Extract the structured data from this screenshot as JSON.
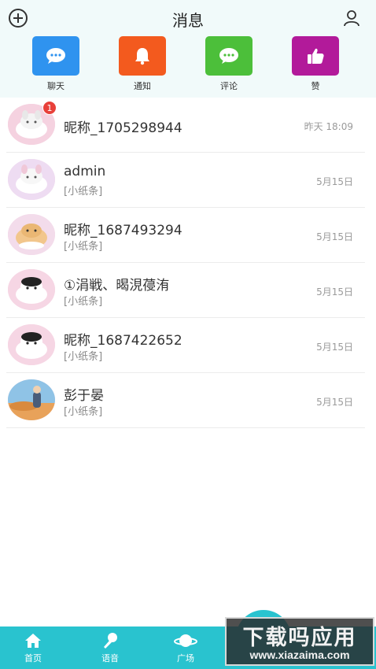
{
  "header": {
    "title": "消息",
    "add_icon": "plus-circle-icon",
    "user_icon": "user-icon"
  },
  "categories": [
    {
      "label": "聊天",
      "icon": "chat-bubble-icon",
      "color": "#2f93ef"
    },
    {
      "label": "通知",
      "icon": "bell-icon",
      "color": "#f35a1e"
    },
    {
      "label": "评论",
      "icon": "comment-icon",
      "color": "#4cbf3a"
    },
    {
      "label": "赞",
      "icon": "thumbs-up-icon",
      "color": "#b21a9a"
    }
  ],
  "messages": [
    {
      "name": "昵称_1705298944",
      "preview": "",
      "time": "昨天 18:09",
      "badge": "1"
    },
    {
      "name": "admin",
      "preview": "[小纸条]",
      "time": "5月15日"
    },
    {
      "name": "昵称_1687493294",
      "preview": "[小纸条]",
      "time": "5月15日"
    },
    {
      "name": "①涓戦、暍涀葠洧",
      "preview": "[小纸条]",
      "time": "5月15日"
    },
    {
      "name": "昵称_1687422652",
      "preview": "[小纸条]",
      "time": "5月15日"
    },
    {
      "name": "彭于晏",
      "preview": "[小纸条]",
      "time": "5月15日"
    }
  ],
  "bottom_nav": [
    {
      "label": "首页",
      "icon": "home-icon"
    },
    {
      "label": "语音",
      "icon": "microphone-icon"
    },
    {
      "label": "广场",
      "icon": "planet-icon"
    }
  ],
  "watermark": {
    "main": "下载吗应用",
    "url": "www.xiazaima.com"
  },
  "colors": {
    "accent": "#29c3cf",
    "badge": "#e8403a",
    "header_bg": "#f1fafa"
  }
}
